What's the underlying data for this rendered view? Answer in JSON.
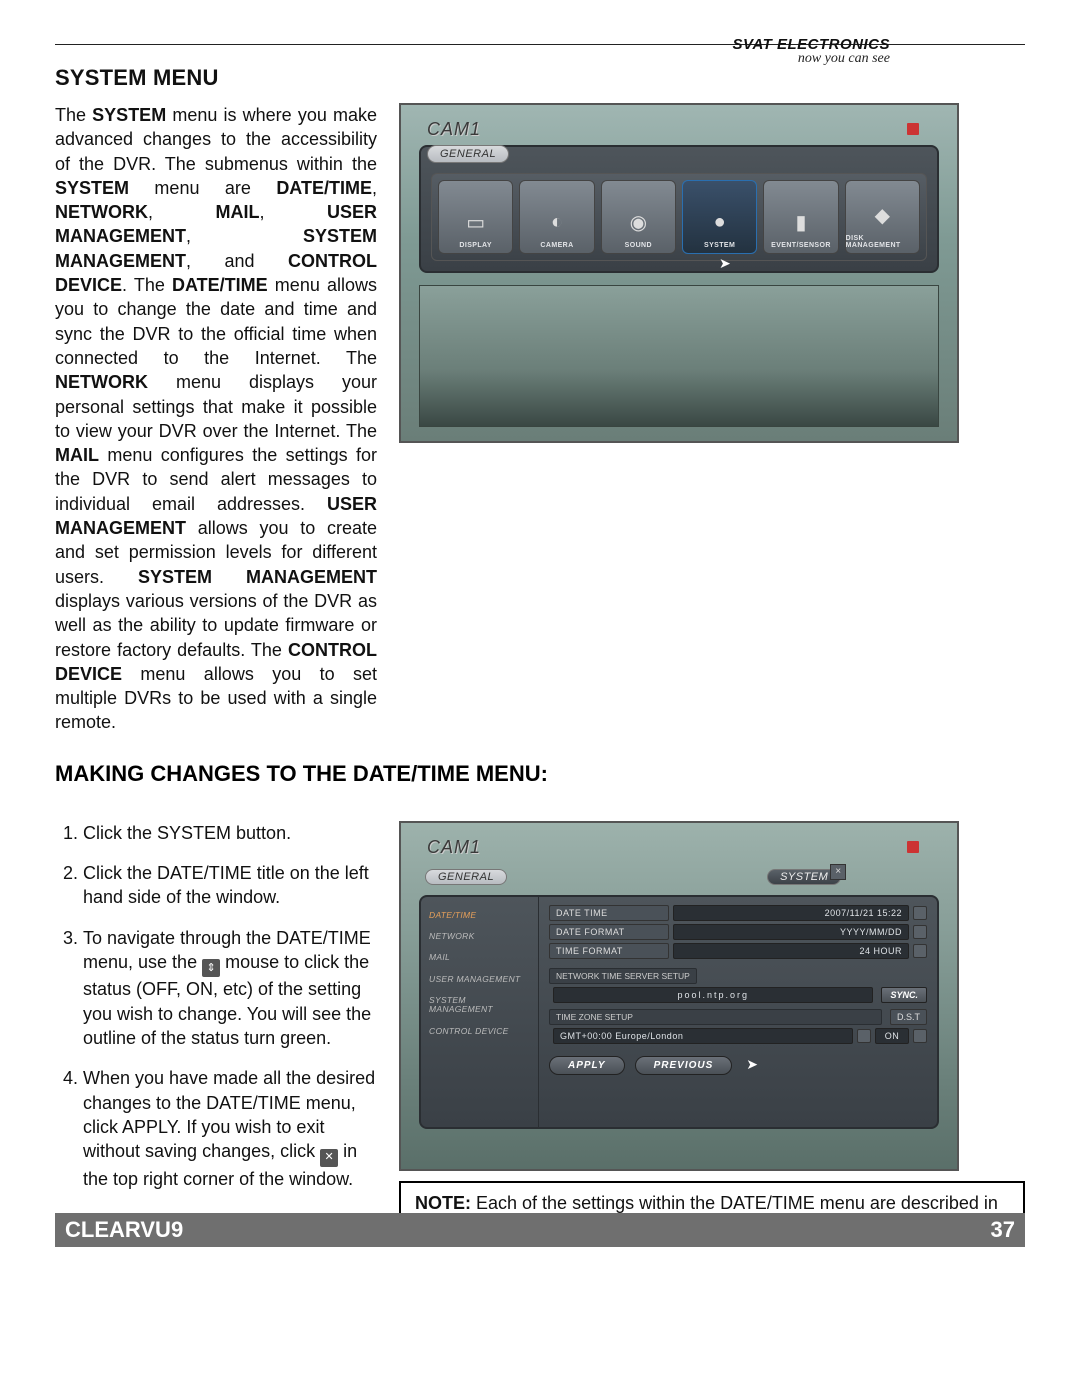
{
  "brand": {
    "name": "SVAT ELECTRONICS",
    "tagline": "now you can see"
  },
  "footer": {
    "model": "CLEARVU9",
    "page": "37"
  },
  "s1": {
    "title": "SYSTEM MENU",
    "p_pre": "The ",
    "p_b1": "SYSTEM",
    "p_1": " menu is where you make advanced changes to the accessibility of the DVR.  The submenus within the ",
    "p_b2": "SYSTEM",
    "p_2": " menu are ",
    "p_b3": "DATE/TIME",
    "p_3": ", ",
    "p_b4": "NETWORK",
    "p_4": ", ",
    "p_b5": "MAIL",
    "p_5": ", ",
    "p_b6": "USER MANAGEMENT",
    "p_6": ", ",
    "p_b7": "SYSTEM MANAGEMENT",
    "p_7": ", and ",
    "p_b8": "CONTROL DEVICE",
    "p_8": ".  The ",
    "p_b9": "DATE/TIME",
    "p_9": " menu allows you to change the date and time and sync the DVR to the official time when connected to the Internet.  The ",
    "p_b10": "NETWORK",
    "p_10": " menu displays your personal settings that make it possible to view your DVR over the Internet.  The ",
    "p_b11": "MAIL",
    "p_11": " menu configures the settings for the DVR to send alert messages to individual email addresses.  ",
    "p_b12": "USER MANAGEMENT",
    "p_12": " allows you to create and set permission levels for different users.  ",
    "p_b13": "SYSTEM MANAGEMENT",
    "p_13": " displays various versions of the DVR as well as the ability to update firmware or restore factory defaults.  The ",
    "p_b14": "CONTROL DEVICE",
    "p_14": " menu allows you to set multiple DVRs to be used with a single remote."
  },
  "shot1": {
    "cam": "CAM1",
    "tab": "GENERAL",
    "icons": [
      {
        "label": "DISPLAY"
      },
      {
        "label": "CAMERA"
      },
      {
        "label": "SOUND"
      },
      {
        "label": "SYSTEM",
        "selected": true
      },
      {
        "label": "EVENT/SENSOR"
      },
      {
        "label": "DISK MANAGEMENT"
      }
    ]
  },
  "s2": {
    "title": "MAKING CHANGES TO THE DATE/TIME MENU:",
    "steps": {
      "i1": "Click the SYSTEM button.",
      "i2": "Click the DATE/TIME title on the left hand side of the window.",
      "i3a": "To navigate through the DATE/TIME menu, use the ",
      "i3b": " mouse to click the status (OFF, ON, etc) of the setting you wish to change.  You will see the outline of the status turn green.",
      "i4a": "When you have made all the desired changes to the DATE/TIME menu, click APPLY.  If you wish to exit without saving changes, click  ",
      "i4b": " in the top right corner of the window."
    }
  },
  "shot2": {
    "cam": "CAM1",
    "crumb1": "GENERAL",
    "crumb2": "SYSTEM",
    "side": [
      {
        "label": "DATE/TIME",
        "active": true
      },
      {
        "label": "NETWORK"
      },
      {
        "label": "MAIL"
      },
      {
        "label": "USER MANAGEMENT"
      },
      {
        "label": "SYSTEM MANAGEMENT"
      },
      {
        "label": "CONTROL DEVICE"
      }
    ],
    "fields": {
      "dt_label": "DATE TIME",
      "dt_value": "2007/11/21 15:22",
      "df_label": "DATE FORMAT",
      "df_value": "YYYY/MM/DD",
      "tf_label": "TIME FORMAT",
      "tf_value": "24 HOUR",
      "ntp_header": "NETWORK TIME SERVER SETUP",
      "ntp_value": "pool.ntp.org",
      "sync": "SYNC.",
      "tz_header": "TIME ZONE SETUP",
      "dst_label": "D.S.T",
      "tz_value": "GMT+00:00 Europe/London",
      "dst_value": "ON",
      "apply": "APPLY",
      "previous": "PREVIOUS"
    }
  },
  "note": {
    "b": "NOTE:",
    "t": " Each of the settings within the DATE/TIME menu are described in detail below."
  }
}
